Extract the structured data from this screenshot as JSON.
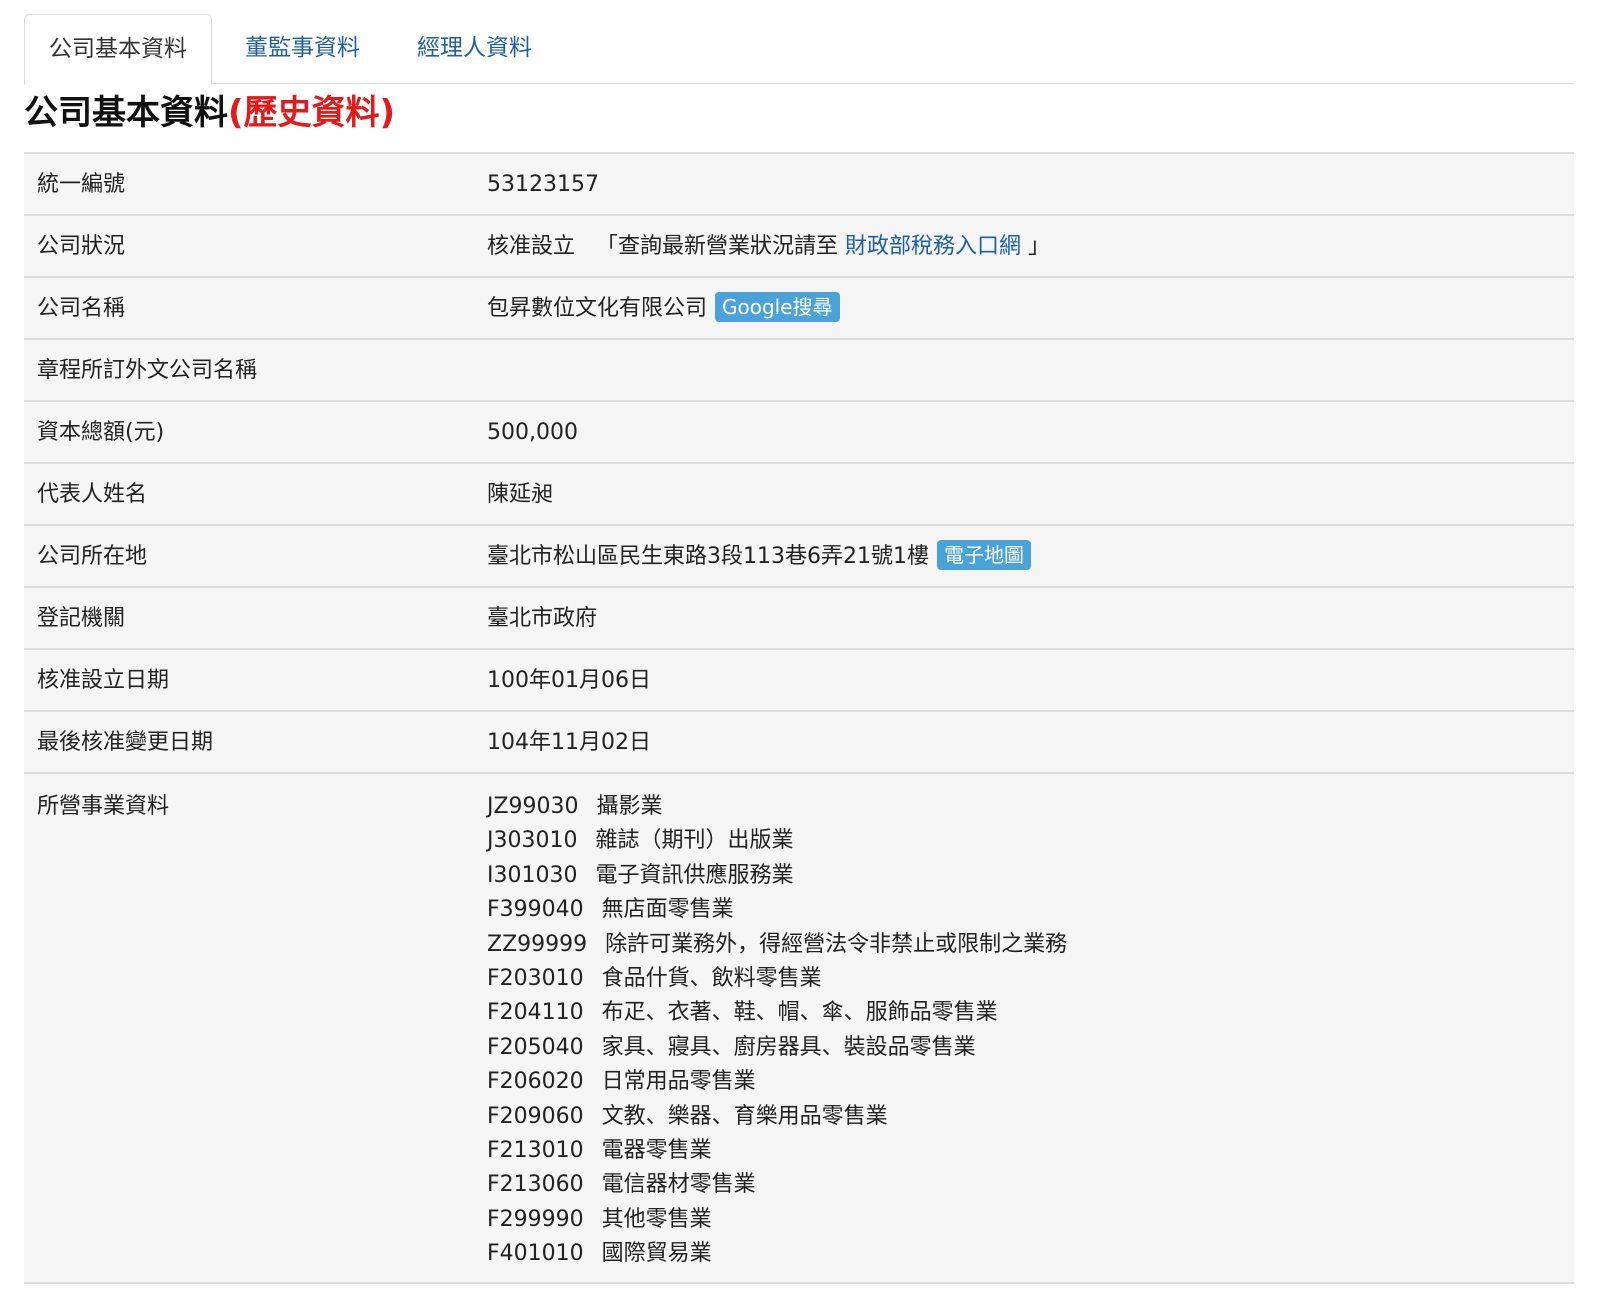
{
  "tabs": [
    {
      "label": "公司基本資料",
      "active": true
    },
    {
      "label": "董監事資料",
      "active": false
    },
    {
      "label": "經理人資料",
      "active": false
    }
  ],
  "title": {
    "main": "公司基本資料",
    "history": "(歷史資料)"
  },
  "rows": {
    "tax_id": {
      "label": "統一編號",
      "value": "53123157"
    },
    "status": {
      "label": "公司狀況",
      "value": "核准設立",
      "note_prefix": "「查詢最新營業狀況請至",
      "link": "財政部稅務入口網",
      "note_suffix": "」"
    },
    "name": {
      "label": "公司名稱",
      "value": "包昇數位文化有限公司",
      "badge": "Google搜尋"
    },
    "foreign_name": {
      "label": "章程所訂外文公司名稱",
      "value": ""
    },
    "capital": {
      "label": "資本總額(元)",
      "value": "500,000"
    },
    "representative": {
      "label": "代表人姓名",
      "value": "陳延昶"
    },
    "address": {
      "label": "公司所在地",
      "value": "臺北市松山區民生東路3段113巷6弄21號1樓",
      "badge": "電子地圖"
    },
    "authority": {
      "label": "登記機關",
      "value": "臺北市政府"
    },
    "established": {
      "label": "核准設立日期",
      "value": "100年01月06日"
    },
    "last_changed": {
      "label": "最後核准變更日期",
      "value": "104年11月02日"
    },
    "business": {
      "label": "所營事業資料"
    }
  },
  "business_items": [
    {
      "code": "JZ99030",
      "name": "攝影業"
    },
    {
      "code": "J303010",
      "name": "雜誌（期刊）出版業"
    },
    {
      "code": "I301030",
      "name": "電子資訊供應服務業"
    },
    {
      "code": "F399040",
      "name": "無店面零售業"
    },
    {
      "code": "ZZ99999",
      "name": "除許可業務外，得經營法令非禁止或限制之業務"
    },
    {
      "code": "F203010",
      "name": "食品什貨、飲料零售業"
    },
    {
      "code": "F204110",
      "name": "布疋、衣著、鞋、帽、傘、服飾品零售業"
    },
    {
      "code": "F205040",
      "name": "家具、寢具、廚房器具、裝設品零售業"
    },
    {
      "code": "F206020",
      "name": "日常用品零售業"
    },
    {
      "code": "F209060",
      "name": "文教、樂器、育樂用品零售業"
    },
    {
      "code": "F213010",
      "name": "電器零售業"
    },
    {
      "code": "F213060",
      "name": "電信器材零售業"
    },
    {
      "code": "F299990",
      "name": "其他零售業"
    },
    {
      "code": "F401010",
      "name": "國際貿易業"
    }
  ],
  "colors": {
    "link": "#1f5fa8",
    "history": "#e41919",
    "badge": "#4aa3d8",
    "row_bg": "#f5f5f5",
    "border": "#dddddd"
  }
}
